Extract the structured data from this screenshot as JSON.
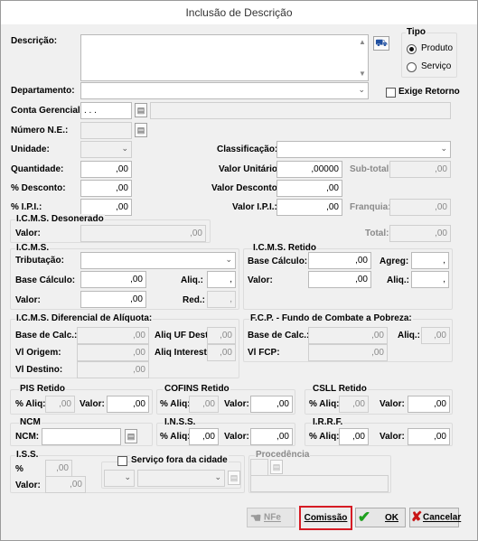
{
  "window": {
    "title": "Inclusão de Descrição"
  },
  "fields": {
    "descricao": {
      "label": "Descrição:",
      "value": ""
    },
    "departamento": {
      "label": "Departamento:",
      "value": ""
    },
    "exige_retorno": {
      "label": "Exige Retorno",
      "checked": false
    },
    "conta_gerencial": {
      "label": "Conta Gerencial:",
      "value": ". . .",
      "desc": ""
    },
    "numero_ne": {
      "label": "Número N.E.:",
      "value": ""
    },
    "unidade": {
      "label": "Unidade:",
      "value": ""
    },
    "classificacao": {
      "label": "Classificação:",
      "value": ""
    },
    "quantidade": {
      "label": "Quantidade:",
      "value": ",00"
    },
    "valor_unitario": {
      "label": "Valor Unitário:",
      "value": ",00000"
    },
    "sub_total": {
      "label": "Sub-total:",
      "value": ",00"
    },
    "pct_desconto": {
      "label": "% Desconto:",
      "value": ",00"
    },
    "valor_desconto": {
      "label": "Valor Desconto:",
      "value": ",00"
    },
    "pct_ipi": {
      "label": "% I.P.I.:",
      "value": ",00"
    },
    "valor_ipi": {
      "label": "Valor I.P.I.:",
      "value": ",00"
    },
    "franquia": {
      "label": "Franquia:",
      "value": ",00"
    },
    "total": {
      "label": "Total:",
      "value": ",00"
    }
  },
  "tipo": {
    "title": "Tipo",
    "options": [
      {
        "label": "Produto",
        "selected": true
      },
      {
        "label": "Serviço",
        "selected": false
      }
    ]
  },
  "icms_deson": {
    "title": "I.C.M.S. Desonerado",
    "valor_label": "Valor:",
    "valor": ",00"
  },
  "icms": {
    "title": "I.C.M.S.",
    "tributacao_label": "Tributação:",
    "tributacao": "",
    "base_label": "Base Cálculo:",
    "base": ",00",
    "aliq_label": "Aliq.:",
    "aliq": ",",
    "valor_label": "Valor:",
    "valor": ",00",
    "red_label": "Red.:",
    "red": ","
  },
  "icms_retido": {
    "title": "I.C.M.S. Retido",
    "base_label": "Base Cálculo:",
    "base": ",00",
    "agreg_label": "Agreg:",
    "agreg": ",",
    "valor_label": "Valor:",
    "valor": ",00",
    "aliq_label": "Aliq.:",
    "aliq": ","
  },
  "difal": {
    "title": "I.C.M.S. Diferencial de Alíquota:",
    "base_label": "Base de Calc.:",
    "base": ",00",
    "aliq_uf_label": "Aliq UF Dest:",
    "aliq_uf": ",00",
    "vl_origem_label": "Vl Origem:",
    "vl_origem": ",00",
    "aliq_int_label": "Aliq Interest:",
    "aliq_int": ",00",
    "vl_destino_label": "Vl Destino:",
    "vl_destino": ",00"
  },
  "fcp": {
    "title": "F.C.P. - Fundo de Combate a Pobreza:",
    "base_label": "Base de Calc.:",
    "base": ",00",
    "aliq_label": "Aliq.:",
    "aliq": ",00",
    "vl_label": "Vl FCP:",
    "vl": ",00"
  },
  "pis": {
    "title": "PIS Retido",
    "aliq_label": "% Aliq:",
    "aliq": ",00",
    "valor_label": "Valor:",
    "valor": ",00"
  },
  "cofins": {
    "title": "COFINS Retido",
    "aliq_label": "% Aliq:",
    "aliq": ",00",
    "valor_label": "Valor:",
    "valor": ",00"
  },
  "csll": {
    "title": "CSLL Retido",
    "aliq_label": "% Aliq:",
    "aliq": ",00",
    "valor_label": "Valor:",
    "valor": ",00"
  },
  "ncm": {
    "title": "NCM",
    "label": "NCM:",
    "value": ""
  },
  "inss": {
    "title": "I.N.S.S.",
    "aliq_label": "% Aliq:",
    "aliq": ",00",
    "valor_label": "Valor:",
    "valor": ",00"
  },
  "irrf": {
    "title": "I.R.R.F.",
    "aliq_label": "% Aliq:",
    "aliq": ",00",
    "valor_label": "Valor:",
    "valor": ",00"
  },
  "iss": {
    "title": "I.S.S.",
    "pct_label": "%",
    "pct": ",00",
    "valor_label": "Valor:",
    "valor": ",00",
    "fora_label": "Serviço fora da cidade"
  },
  "procedencia": {
    "title": "Procedência"
  },
  "buttons": {
    "nfe": "NFe",
    "comissao": "Comissão",
    "ok": "OK",
    "cancelar": "Cancelar"
  },
  "colors": {
    "highlight": "#d61b24",
    "ok_green": "#1ea01e",
    "cancel_red": "#c81414"
  }
}
